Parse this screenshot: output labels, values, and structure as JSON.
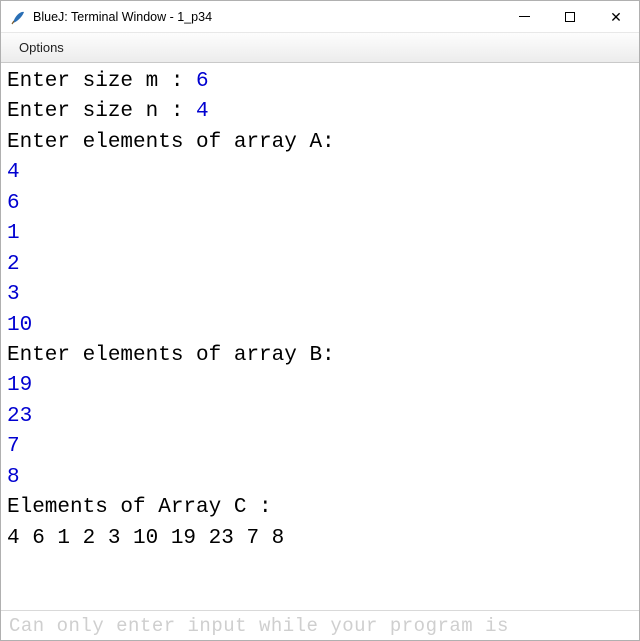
{
  "titlebar": {
    "title": "BlueJ: Terminal Window - 1_p34"
  },
  "menubar": {
    "options": "Options"
  },
  "terminal": {
    "lines": [
      {
        "prompt": "Enter size m : ",
        "input": "6"
      },
      {
        "prompt": "Enter size n : ",
        "input": "4"
      },
      {
        "prompt": "Enter elements of array A:",
        "input": ""
      },
      {
        "prompt": "",
        "input": "4"
      },
      {
        "prompt": "",
        "input": "6"
      },
      {
        "prompt": "",
        "input": "1"
      },
      {
        "prompt": "",
        "input": "2"
      },
      {
        "prompt": "",
        "input": "3"
      },
      {
        "prompt": "",
        "input": "10"
      },
      {
        "prompt": "Enter elements of array B:",
        "input": ""
      },
      {
        "prompt": "",
        "input": "19"
      },
      {
        "prompt": "",
        "input": "23"
      },
      {
        "prompt": "",
        "input": "7"
      },
      {
        "prompt": "",
        "input": "8"
      },
      {
        "prompt": "Elements of Array C :",
        "input": ""
      },
      {
        "prompt": "4 6 1 2 3 10 19 23 7 8 ",
        "input": ""
      }
    ]
  },
  "inputbar": {
    "placeholder": "Can only enter input while your program is "
  },
  "icons": {
    "app_icon_fill": "#2a6fb5"
  }
}
